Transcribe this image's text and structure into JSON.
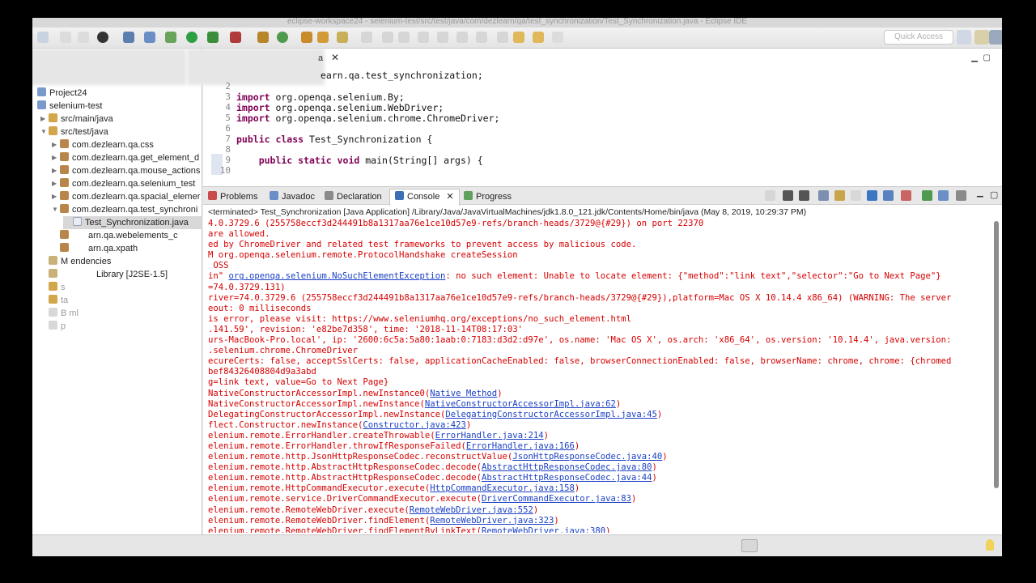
{
  "window_title": "eclipse-workspace24 - selenium-test/src/test/java/com/dezlearn/qa/test_synchronization/Test_Synchronization.java - Eclipse IDE",
  "toolbar": {
    "quick_access_placeholder": "Quick Access"
  },
  "package_explorer": {
    "items": [
      {
        "label": "Project24"
      },
      {
        "label": "selenium-test"
      },
      {
        "label": "src/main/java"
      },
      {
        "label": "src/test/java"
      },
      {
        "label": "com.dezlearn.qa.css"
      },
      {
        "label": "com.dezlearn.qa.get_element_d"
      },
      {
        "label": "com.dezlearn.qa.mouse_actions"
      },
      {
        "label": "com.dezlearn.qa.selenium_test"
      },
      {
        "label": "com.dezlearn.qa.spacial_elemer"
      },
      {
        "label": "com.dezlearn.qa.test_synchroni"
      },
      {
        "label": "Test_Synchronization.java"
      },
      {
        "label": "arn.qa.webelements_c"
      },
      {
        "label": "arn.qa.xpath"
      },
      {
        "label": "M   endencies"
      },
      {
        "label": "Library [J2SE-1.5]"
      },
      {
        "label": "s"
      },
      {
        "label": "ta"
      },
      {
        "label": "B          ml"
      },
      {
        "label": "p"
      }
    ]
  },
  "editor": {
    "tab_fragment": "a",
    "line1_text": "earn.qa.test_synchronization;",
    "lines": [
      {
        "n": "2",
        "kw": "",
        "text": ""
      },
      {
        "n": "3",
        "kw": "import",
        "text": " org.openqa.selenium.By;"
      },
      {
        "n": "4",
        "kw": "import",
        "text": " org.openqa.selenium.WebDriver;"
      },
      {
        "n": "5",
        "kw": "import",
        "text": " org.openqa.selenium.chrome.ChromeDriver;"
      },
      {
        "n": "6",
        "kw": "",
        "text": ""
      },
      {
        "n": "7",
        "kw": "public class",
        "text": " Test_Synchronization {"
      },
      {
        "n": "8",
        "kw": "",
        "text": ""
      },
      {
        "n": "9",
        "kw": "    public static void",
        "text": " main(String[] args) {"
      },
      {
        "n": "10",
        "kw": "",
        "text": ""
      }
    ]
  },
  "views": {
    "tabs": [
      {
        "label": "Problems"
      },
      {
        "label": "Javadoc"
      },
      {
        "label": "Declaration"
      },
      {
        "label": "Console"
      },
      {
        "label": "Progress"
      }
    ],
    "terminated_line": "<terminated> Test_Synchronization [Java Application] /Library/Java/JavaVirtualMachines/jdk1.8.0_121.jdk/Contents/Home/bin/java (May 8, 2019, 10:29:37 PM)",
    "console_lines": [
      {
        "pre": "4.0.3729.6 (255758eccf3d244491b8a1317aa76e1ce10d57e9-refs/branch-heads/3729@{#29}) on port 22370",
        "link": "",
        "post": ""
      },
      {
        "pre": "are allowed.",
        "link": "",
        "post": ""
      },
      {
        "pre": "ed by ChromeDriver and related test frameworks to prevent access by malicious code.",
        "link": "",
        "post": ""
      },
      {
        "pre": "M org.openqa.selenium.remote.ProtocolHandshake createSession",
        "link": "",
        "post": ""
      },
      {
        "pre": " OSS",
        "link": "",
        "post": ""
      },
      {
        "pre": "in\" ",
        "link": "org.openqa.selenium.NoSuchElementException",
        "post": ": no such element: Unable to locate element: {\"method\":\"link text\",\"selector\":\"Go to Next Page\"}"
      },
      {
        "pre": "=74.0.3729.131)",
        "link": "",
        "post": ""
      },
      {
        "pre": "river=74.0.3729.6 (255758eccf3d244491b8a1317aa76e1ce10d57e9-refs/branch-heads/3729@{#29}),platform=Mac OS X 10.14.4 x86_64) (WARNING: The server",
        "link": "",
        "post": ""
      },
      {
        "pre": "eout: 0 milliseconds",
        "link": "",
        "post": ""
      },
      {
        "pre": "is error, please visit: https://www.seleniumhq.org/exceptions/no_such_element.html",
        "link": "",
        "post": ""
      },
      {
        "pre": ".141.59', revision: 'e82be7d358', time: '2018-11-14T08:17:03'",
        "link": "",
        "post": ""
      },
      {
        "pre": "urs-MacBook-Pro.local', ip: '2600:6c5a:5a80:1aab:0:7183:d3d2:d97e', os.name: 'Mac OS X', os.arch: 'x86_64', os.version: '10.14.4', java.version:",
        "link": "",
        "post": ""
      },
      {
        "pre": ".selenium.chrome.ChromeDriver",
        "link": "",
        "post": ""
      },
      {
        "pre": "ecureCerts: false, acceptSslCerts: false, applicationCacheEnabled: false, browserConnectionEnabled: false, browserName: chrome, chrome: {chromed",
        "link": "",
        "post": ""
      },
      {
        "pre": "bef84326408804d9a3abd",
        "link": "",
        "post": ""
      },
      {
        "pre": "g=link text, value=Go to Next Page}",
        "link": "",
        "post": ""
      },
      {
        "pre": "NativeConstructorAccessorImpl.newInstance0(",
        "link": "Native Method",
        "post": ")"
      },
      {
        "pre": "NativeConstructorAccessorImpl.newInstance(",
        "link": "NativeConstructorAccessorImpl.java:62",
        "post": ")"
      },
      {
        "pre": "DelegatingConstructorAccessorImpl.newInstance(",
        "link": "DelegatingConstructorAccessorImpl.java:45",
        "post": ")"
      },
      {
        "pre": "flect.Constructor.newInstance(",
        "link": "Constructor.java:423",
        "post": ")"
      },
      {
        "pre": "elenium.remote.ErrorHandler.createThrowable(",
        "link": "ErrorHandler.java:214",
        "post": ")"
      },
      {
        "pre": "elenium.remote.ErrorHandler.throwIfResponseFailed(",
        "link": "ErrorHandler.java:166",
        "post": ")"
      },
      {
        "pre": "elenium.remote.http.JsonHttpResponseCodec.reconstructValue(",
        "link": "JsonHttpResponseCodec.java:40",
        "post": ")"
      },
      {
        "pre": "elenium.remote.http.AbstractHttpResponseCodec.decode(",
        "link": "AbstractHttpResponseCodec.java:80",
        "post": ")"
      },
      {
        "pre": "elenium.remote.http.AbstractHttpResponseCodec.decode(",
        "link": "AbstractHttpResponseCodec.java:44",
        "post": ")"
      },
      {
        "pre": "elenium.remote.HttpCommandExecutor.execute(",
        "link": "HttpCommandExecutor.java:158",
        "post": ")"
      },
      {
        "pre": "elenium.remote.service.DriverCommandExecutor.execute(",
        "link": "DriverCommandExecutor.java:83",
        "post": ")"
      },
      {
        "pre": "elenium.remote.RemoteWebDriver.execute(",
        "link": "RemoteWebDriver.java:552",
        "post": ")"
      },
      {
        "pre": "elenium.remote.RemoteWebDriver.findElement(",
        "link": "RemoteWebDriver.java:323",
        "post": ")"
      },
      {
        "pre": "elenium.remote.RemoteWebDriver.findElementByLinkText(",
        "link": "RemoteWebDriver.java:380",
        "post": ")"
      }
    ]
  },
  "colors": {
    "error_text": "#d60000",
    "link": "#1a3fc4",
    "keyword": "#7f0055"
  }
}
